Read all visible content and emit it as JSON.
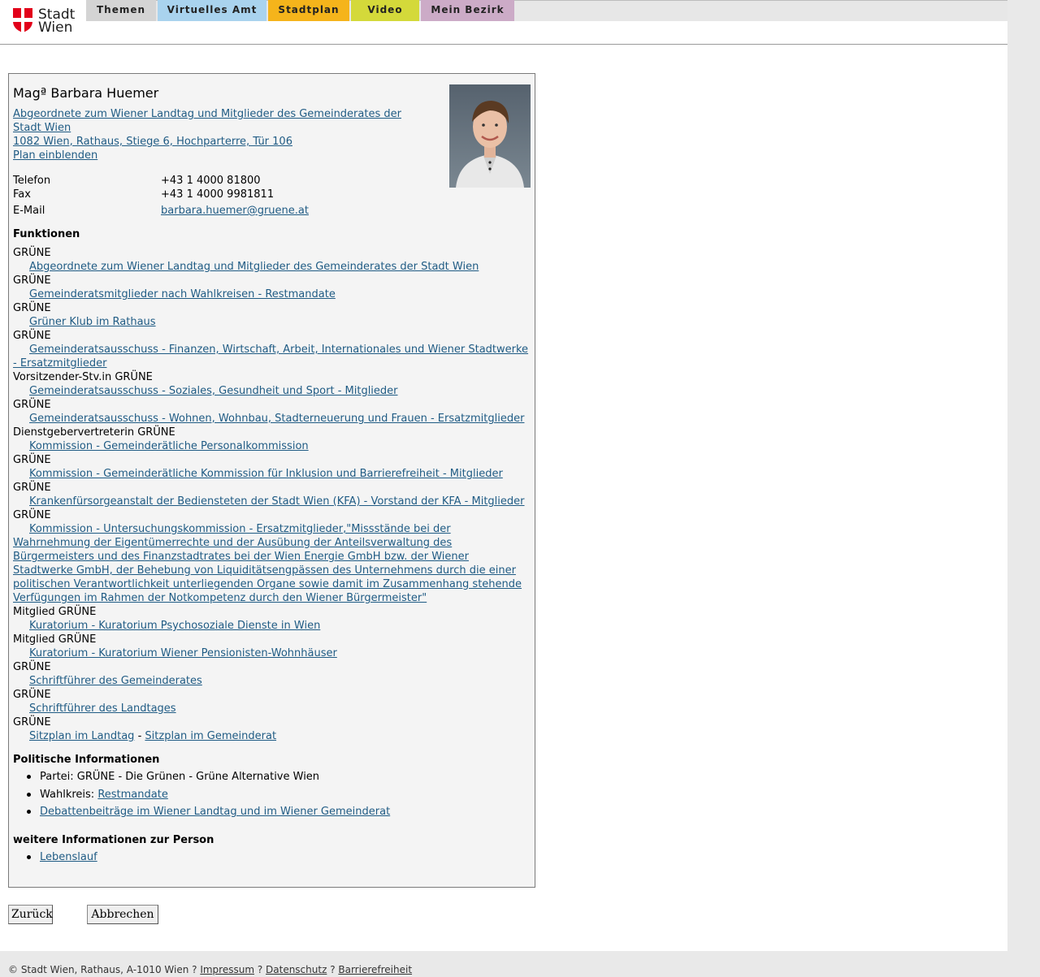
{
  "header": {
    "logo_line1": "Stadt",
    "logo_line2": "Wien",
    "tabs": [
      {
        "label": "Themen",
        "color": "#d4d4d4"
      },
      {
        "label": "Virtuelles Amt",
        "color": "#a9d3ee"
      },
      {
        "label": "Stadtplan",
        "color": "#f5b41b"
      },
      {
        "label": "Video",
        "color": "#d4d93a"
      },
      {
        "label": "Mein Bezirk",
        "color": "#ccabc7"
      }
    ]
  },
  "person": {
    "name": "Magª Barbara Huemer",
    "role_link_line1": "Abgeordnete zum Wiener Landtag und Mitglieder des Gemeinderates der",
    "role_link_line2": "Stadt Wien ",
    "address": "1082 Wien, Rathaus, Stiege 6, Hochparterre, Tür 106",
    "plan_link": "Plan einblenden",
    "contacts": [
      {
        "label": "Telefon",
        "value": "+43 1 4000 81800"
      },
      {
        "label": "Fax",
        "value": "+43 1 4000 9981811"
      },
      {
        "label": "E-Mail",
        "value": "barbara.huemer@gruene.at"
      }
    ]
  },
  "functions": {
    "heading": "Funktionen",
    "items": [
      {
        "role": "GRÜNE",
        "link": "Abgeordnete zum Wiener Landtag und Mitglieder des Gemeinderates der Stadt Wien"
      },
      {
        "role": "GRÜNE",
        "link": "Gemeinderatsmitglieder nach Wahlkreisen - Restmandate"
      },
      {
        "role": "GRÜNE",
        "link": "Grüner Klub im Rathaus"
      },
      {
        "role": "GRÜNE",
        "link_line1": "Gemeinderatsausschuss - Finanzen, Wirtschaft, Arbeit, Internationales und Wiener Stadtwerke",
        "link_line2": "- Ersatzmitglieder"
      },
      {
        "role": "Vorsitzender-Stv.in GRÜNE",
        "link": "Gemeinderatsausschuss - Soziales, Gesundheit und Sport - Mitglieder"
      },
      {
        "role": "GRÜNE",
        "link": "Gemeinderatsausschuss - Wohnen, Wohnbau, Stadterneuerung und Frauen - Ersatzmitglieder"
      },
      {
        "role": "Dienstgebervertreterin GRÜNE",
        "link": "Kommission - Gemeinderätliche Personalkommission"
      },
      {
        "role": "GRÜNE",
        "link": "Kommission - Gemeinderätliche Kommission für Inklusion und Barrierefreiheit - Mitglieder"
      },
      {
        "role": "GRÜNE",
        "link": "Krankenfürsorgeanstalt der Bediensteten der Stadt Wien (KFA) - Vorstand der KFA - Mitglieder"
      },
      {
        "role": "GRÜNE",
        "link_lines": [
          "Kommission - Untersuchungskommission - Ersatzmitglieder,\"Missstände bei der",
          "Wahrnehmung der Eigentümerrechte und der Ausübung der Anteilsverwaltung des",
          "Bürgermeisters und des Finanzstadtrates bei der Wien Energie GmbH bzw. der Wiener",
          "Stadtwerke GmbH, der Behebung von Liquiditätsengpässen des Unternehmens durch die einer",
          "politischen Verantwortlichkeit unterliegenden Organe sowie damit im Zusammenhang stehende",
          "Verfügungen im Rahmen der Notkompetenz durch den Wiener Bürgermeister\""
        ]
      },
      {
        "role": "Mitglied GRÜNE",
        "link": "Kuratorium - Kuratorium Psychosoziale Dienste in Wien"
      },
      {
        "role": "Mitglied GRÜNE",
        "link": "Kuratorium - Kuratorium Wiener Pensionisten-Wohnhäuser"
      },
      {
        "role": "GRÜNE",
        "link": "Schriftführer des Gemeinderates"
      },
      {
        "role": "GRÜNE",
        "link": "Schriftführer des Landtages"
      },
      {
        "role": "GRÜNE",
        "link_a": "Sitzplan im Landtag",
        "separator": "-",
        "link_b": "Sitzplan im Gemeinderat"
      }
    ]
  },
  "political": {
    "heading": "Politische Informationen",
    "party": "Partei: GRÜNE - Die Grünen - Grüne Alternative Wien",
    "district_label": "Wahlkreis: ",
    "district_link": "Restmandate",
    "debates_link": "Debattenbeiträge im Wiener Landtag und im Wiener Gemeinderat"
  },
  "more": {
    "heading": "weitere Informationen zur Person",
    "cv_link": "Lebenslauf"
  },
  "buttons": {
    "back": "Zurück",
    "cancel": "Abbrechen"
  },
  "footer": {
    "copyright": "© Stadt Wien, Rathaus, A-1010 Wien ? ",
    "impressum": "Impressum",
    "sep1": " ? ",
    "privacy": "Datenschutz",
    "sep2": " ? ",
    "accessibility": "Barrierefreiheit"
  }
}
